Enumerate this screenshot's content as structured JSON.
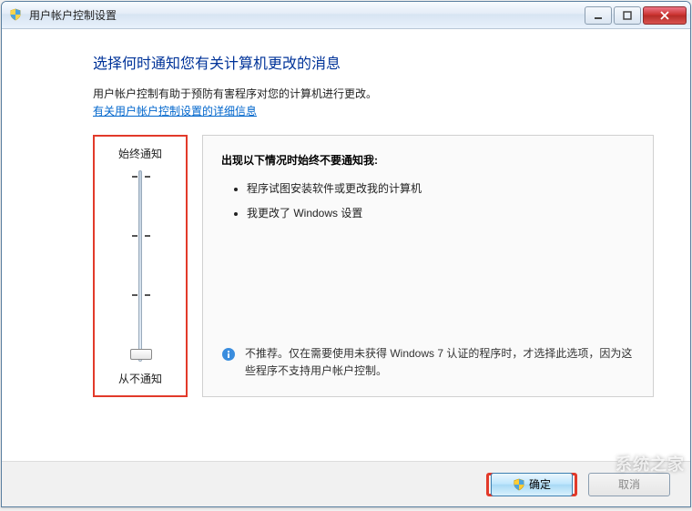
{
  "window": {
    "title": "用户帐户控制设置"
  },
  "page": {
    "heading": "选择何时通知您有关计算机更改的消息",
    "description": "用户帐户控制有助于预防有害程序对您的计算机进行更改。",
    "link_text": "有关用户帐户控制设置的详细信息"
  },
  "slider": {
    "top_label": "始终通知",
    "bottom_label": "从不通知",
    "level": "never"
  },
  "panel": {
    "heading": "出现以下情况时始终不要通知我:",
    "bullets": [
      "程序试图安装软件或更改我的计算机",
      "我更改了 Windows 设置"
    ],
    "note_text": "不推荐。仅在需要使用未获得 Windows 7 认证的程序时，才选择此选项，因为这些程序不支持用户帐户控制。"
  },
  "buttons": {
    "ok": "确定",
    "cancel": "取消"
  },
  "watermark": "系统之家"
}
